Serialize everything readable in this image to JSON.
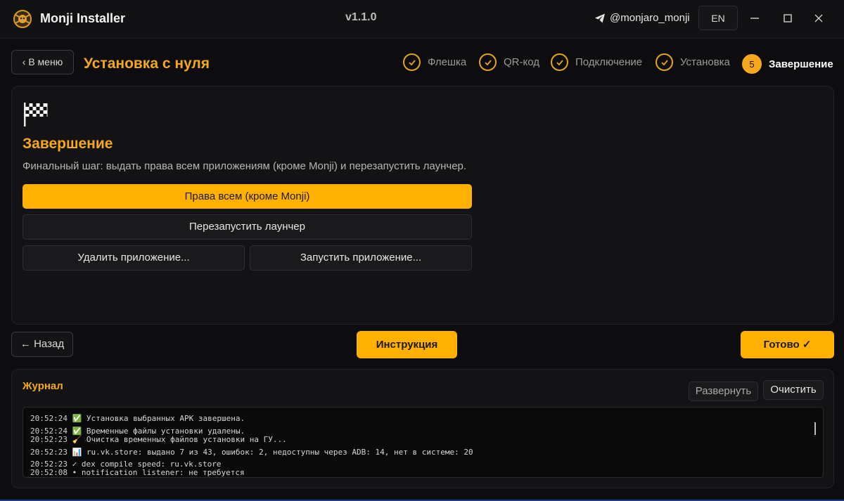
{
  "window": {
    "title": "Monji Installer",
    "version": "v1.1.0",
    "telegram_handle": "@monjaro_monji",
    "language_button": "EN"
  },
  "header": {
    "back_menu_label": "‹ В меню",
    "page_title": "Установка с нуля"
  },
  "steps": [
    {
      "label": "Флешка",
      "state": "done"
    },
    {
      "label": "QR-код",
      "state": "done"
    },
    {
      "label": "Подключение",
      "state": "done"
    },
    {
      "label": "Установка",
      "state": "done"
    },
    {
      "label": "Завершение",
      "state": "active",
      "number": "5"
    }
  ],
  "section": {
    "title": "Завершение",
    "description": "Финальный шаг: выдать права всем приложениям (кроме Monji) и перезапустить лаунчер.",
    "buttons": {
      "grant_all": "Права всем (кроме Monji)",
      "restart_launcher": "Перезапустить лаунчер",
      "uninstall_app": "Удалить приложение...",
      "launch_app": "Запустить приложение..."
    }
  },
  "nav": {
    "back_label": "← Назад",
    "instructions_label": "Инструкция",
    "done_label": "Готово ✓"
  },
  "log": {
    "title": "Журнал",
    "expand_label": "Развернуть",
    "clear_label": "Очистить",
    "lines": [
      {
        "time": "20:52:24",
        "text": "✅ Установка выбранных APK завершена."
      },
      {
        "time": "20:52:24",
        "text": "✅ Временные файлы установки удалены."
      },
      {
        "time": "20:52:23",
        "text": "🧹 Очистка временных файлов установки на ГУ..."
      },
      {
        "time": "20:52:23",
        "text": "📊 ru.vk.store: выдано 7 из 43, ошибок: 2, недоступны через ADB: 14, нет в системе: 20"
      },
      {
        "time": "20:52:23",
        "text": "✓ dex compile speed: ru.vk.store"
      },
      {
        "time": "20:52:08",
        "text": "• notification listener: не требуется"
      }
    ]
  },
  "colors": {
    "accent": "#ffb000",
    "accent_text": "#f5a81c",
    "background": "#0d0d0f",
    "card": "#131315"
  }
}
